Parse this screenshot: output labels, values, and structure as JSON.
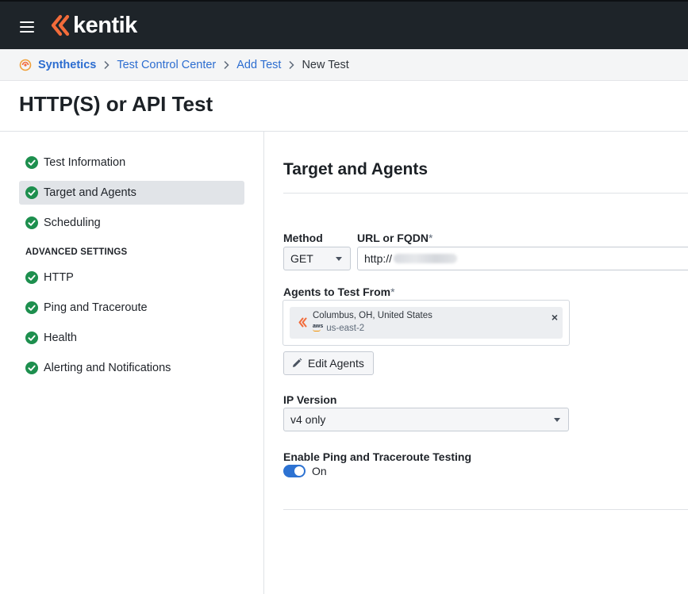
{
  "app": {
    "brand": "kentik"
  },
  "breadcrumb": {
    "items": [
      "Synthetics",
      "Test Control Center",
      "Add Test"
    ],
    "current": "New Test"
  },
  "page": {
    "title": "HTTP(S) or API Test"
  },
  "sidebar": {
    "items": [
      {
        "label": "Test Information",
        "status": "complete"
      },
      {
        "label": "Target and Agents",
        "status": "complete",
        "active": true
      },
      {
        "label": "Scheduling",
        "status": "complete"
      }
    ],
    "advanced_heading": "ADVANCED SETTINGS",
    "advanced_items": [
      {
        "label": "HTTP",
        "status": "complete"
      },
      {
        "label": "Ping and Traceroute",
        "status": "complete"
      },
      {
        "label": "Health",
        "status": "complete"
      },
      {
        "label": "Alerting and Notifications",
        "status": "complete"
      }
    ]
  },
  "form": {
    "section_title": "Target and Agents",
    "method": {
      "label": "Method",
      "value": "GET"
    },
    "url": {
      "label": "URL or FQDN",
      "required_mark": "*",
      "value_prefix": "http://"
    },
    "agents": {
      "label": "Agents to Test From",
      "required_mark": "*",
      "selected": [
        {
          "name": "Columbus, OH, United States",
          "provider_icon": "aws-icon",
          "region": "us-east-2"
        }
      ],
      "remove_glyph": "×",
      "edit_button": "Edit Agents"
    },
    "ip_version": {
      "label": "IP Version",
      "value": "v4 only"
    },
    "ping_traceroute": {
      "label": "Enable Ping and Traceroute Testing",
      "enabled": true,
      "state_label": "On"
    }
  },
  "colors": {
    "topbar": "#1e2429",
    "brand_accent": "#f26b3a",
    "link": "#2c6dd0",
    "success": "#1d8f4e",
    "toggle_on": "#2d72d2"
  }
}
